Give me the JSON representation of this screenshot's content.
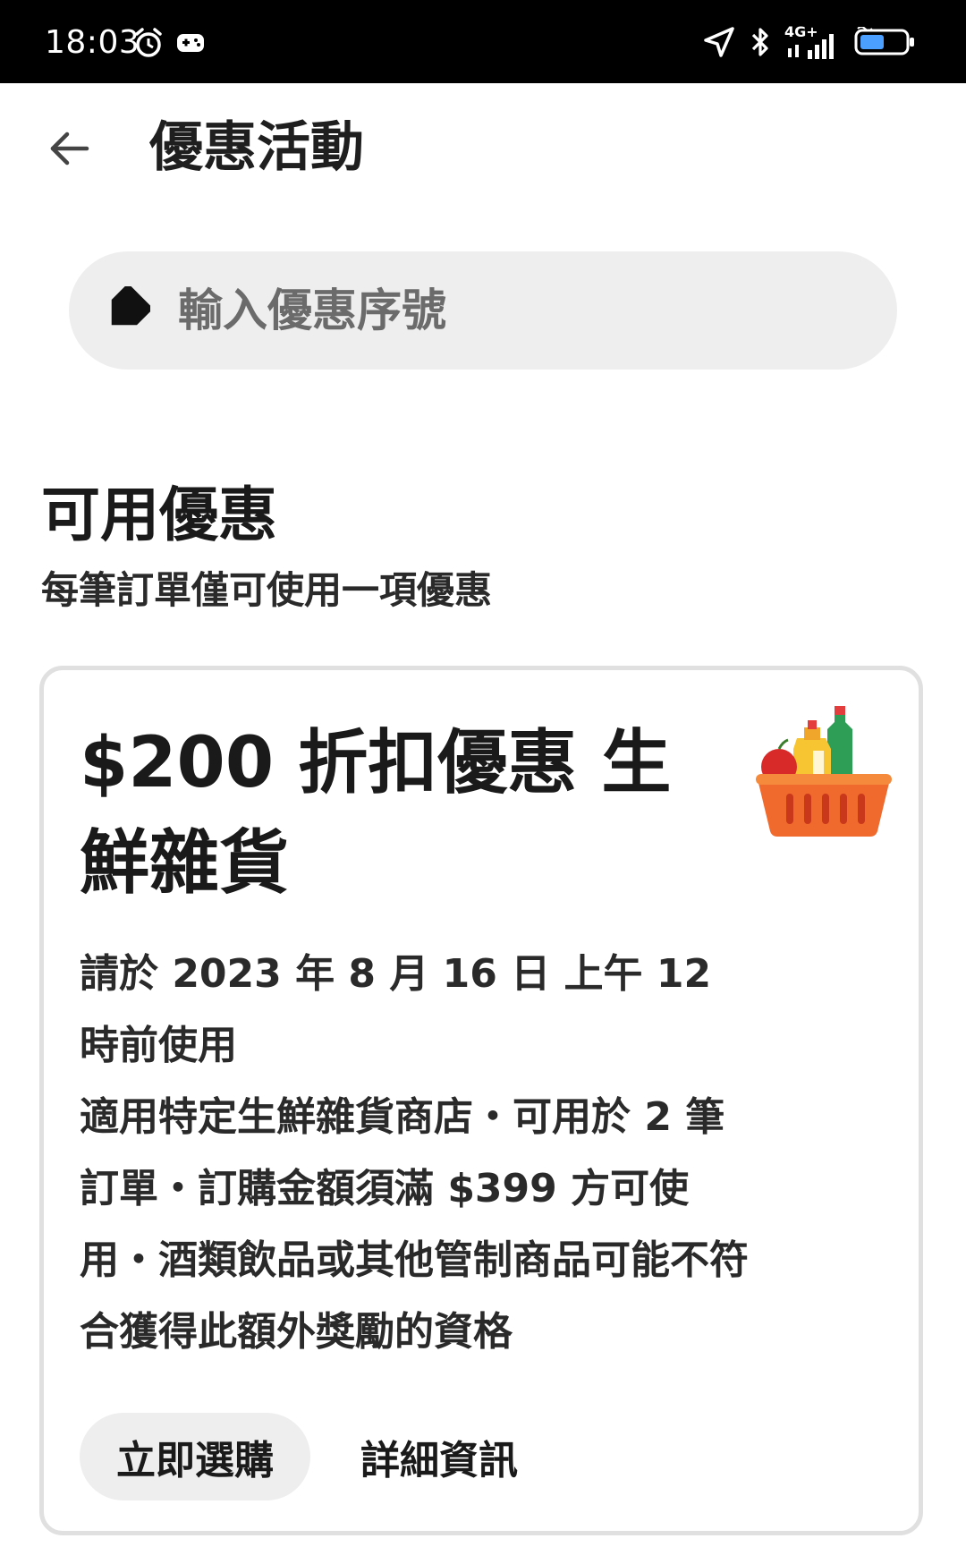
{
  "status_bar": {
    "time": "18:03",
    "network": "4G+",
    "icons": [
      "alarm-icon",
      "gamepad-icon",
      "location-arrow-icon",
      "bluetooth-icon",
      "signal-icon",
      "battery-icon"
    ]
  },
  "header": {
    "title": "優惠活動",
    "back_icon": "arrow-left-icon"
  },
  "promo_input": {
    "placeholder": "輸入優惠序號",
    "icon": "tag-icon"
  },
  "section": {
    "title": "可用優惠",
    "subtitle": "每筆訂單僅可使用一項優惠"
  },
  "offer": {
    "title": "$200 折扣優惠 生鮮雜貨",
    "icon": "grocery-basket-icon",
    "expiry": "請於 2023 年 8 月 16 日 上午 12 時前使用",
    "terms": "適用特定生鮮雜貨商店・可用於 2 筆訂單・訂購金額須滿 $399 方可使用・酒類飲品或其他管制商品可能不符合獲得此額外獎勵的資格",
    "shop_now_label": "立即選購",
    "details_label": "詳細資訊"
  },
  "colors": {
    "status_bar_bg": "#000000",
    "input_bg": "#eeeeee",
    "card_border": "#e0e0e0",
    "text_primary": "#1a1a1a",
    "placeholder": "#6b6b6b"
  }
}
